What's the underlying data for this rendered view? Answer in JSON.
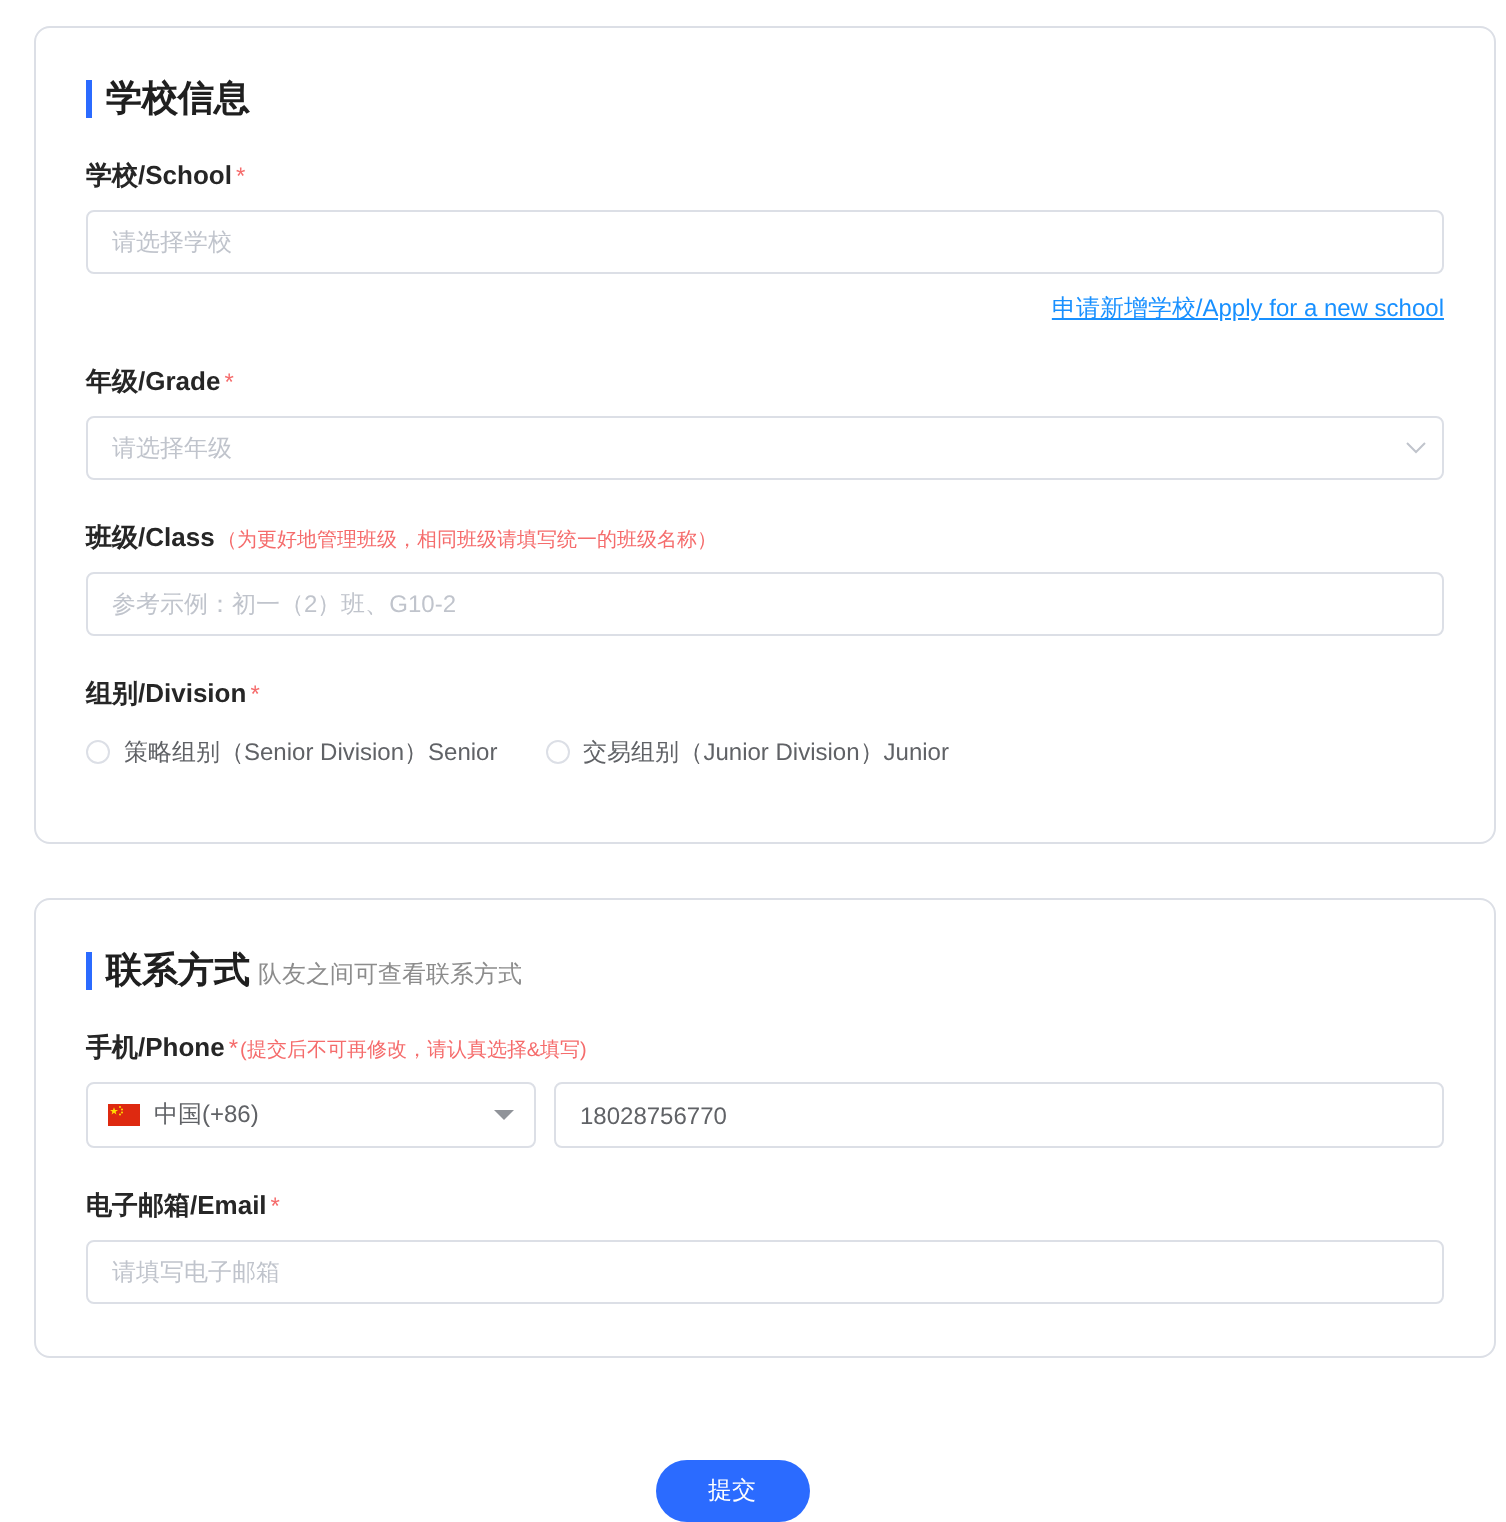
{
  "sections": [
    {
      "title": "学校信息",
      "fields": [
        {
          "kind": "input",
          "label": "学校/School",
          "required_mark": "*",
          "placeholder": "请选择学校",
          "link": "申请新增学校/Apply for a new school"
        },
        {
          "kind": "select",
          "label": "年级/Grade",
          "required_mark": "*",
          "placeholder": "请选择年级"
        },
        {
          "kind": "input",
          "label": "班级/Class",
          "hint": "（为更好地管理班级，相同班级请填写统一的班级名称）",
          "placeholder": "参考示例：初一（2）班、G10-2"
        },
        {
          "kind": "radio",
          "label": "组别/Division",
          "required_mark": "*",
          "options": [
            {
              "label": "策略组别（Senior Division）Senior",
              "selected": false
            },
            {
              "label": "交易组别（Junior Division）Junior",
              "selected": false
            }
          ]
        }
      ]
    },
    {
      "title": "联系方式",
      "subtitle": "队友之间可查看联系方式",
      "fields": [
        {
          "kind": "phone",
          "label": "手机/Phone",
          "required_mark": "*",
          "hint": "(提交后不可再修改，请认真选择&填写)",
          "country": "中国(+86)",
          "value": "18028756770"
        },
        {
          "kind": "input",
          "label": "电子邮箱/Email",
          "required_mark": "*",
          "placeholder": "请填写电子邮箱"
        }
      ]
    }
  ],
  "submit": "提交"
}
